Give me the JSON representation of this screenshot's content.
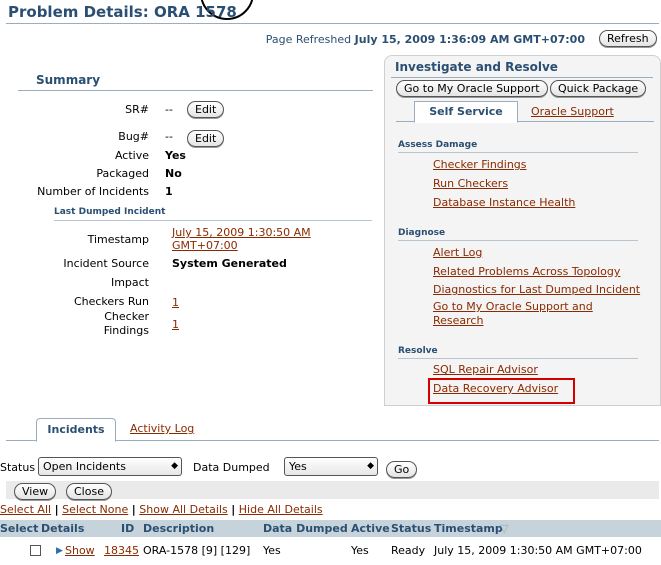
{
  "page": {
    "title": "Problem Details: ORA 1578",
    "refreshed_label": "Page Refreshed",
    "refreshed_time": "July 15, 2009 1:36:09 AM GMT+07:00",
    "refresh_button": "Refresh"
  },
  "summary": {
    "heading": "Summary",
    "sr_label": "SR#",
    "sr_value": "--",
    "bug_label": "Bug#",
    "bug_value": "--",
    "edit_label": "Edit",
    "active_label": "Active",
    "active_value": "Yes",
    "packaged_label": "Packaged",
    "packaged_value": "No",
    "incidents_label": "Number of Incidents",
    "incidents_value": "1",
    "last_dumped_heading": "Last Dumped Incident",
    "timestamp_label": "Timestamp",
    "timestamp_line1": "July 15, 2009 1:30:50 AM",
    "timestamp_line2": "GMT+07:00",
    "source_label": "Incident Source",
    "source_value": "System Generated",
    "impact_label": "Impact",
    "checkers_run_label": "Checkers Run",
    "checkers_run_value": "1",
    "checker_findings_label_1": "Checker",
    "checker_findings_label_2": "Findings",
    "checker_findings_value": "1"
  },
  "investigate": {
    "title": "Investigate and Resolve",
    "go_mos_button": "Go to My Oracle Support",
    "quick_package_button": "Quick Package",
    "tab_self_service": "Self Service",
    "tab_oracle_support": "Oracle Support",
    "assess_heading": "Assess Damage",
    "assess_links": [
      "Checker Findings",
      "Run Checkers",
      "Database Instance Health"
    ],
    "diagnose_heading": "Diagnose",
    "diagnose_links": [
      "Alert Log",
      "Related Problems Across Topology",
      "Diagnostics for Last Dumped Incident",
      "Go to My Oracle Support and",
      "Research"
    ],
    "resolve_heading": "Resolve",
    "resolve_links": [
      "SQL Repair Advisor",
      "Data Recovery Advisor"
    ]
  },
  "tabs": {
    "incidents": "Incidents",
    "activity_log": "Activity Log"
  },
  "filters": {
    "status_label": "Status",
    "status_value": "Open Incidents",
    "dumped_label": "Data Dumped",
    "dumped_value": "Yes",
    "go_button": "Go",
    "view_button": "View",
    "close_button": "Close"
  },
  "selection": {
    "select_all": "Select All",
    "select_none": "Select None",
    "show_all": "Show All Details",
    "hide_all": "Hide All Details"
  },
  "table": {
    "headers": [
      "Select",
      "Details",
      "ID",
      "Description",
      "Data Dumped",
      "Active",
      "Status",
      "Timestamp"
    ],
    "rows": [
      [
        "",
        "Show",
        "18345",
        "ORA-1578 [9] [129]",
        "Yes",
        "Yes",
        "Ready",
        "July 15, 2009 1:30:50 AM GMT+07:00"
      ]
    ]
  },
  "colors": {
    "heading_blue": "#2a4f72",
    "link_brown": "#8a2a00",
    "highlight_red": "#d40000"
  }
}
